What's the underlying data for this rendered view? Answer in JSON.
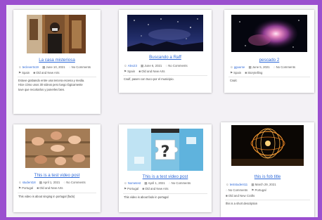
{
  "posts": [
    {
      "title": "La casa misteriosa",
      "author": "tecleverts19",
      "date": "June 10, 2021",
      "comments": "No Comments",
      "language": "Spain",
      "category": "Old and New Arts",
      "excerpt_lines": [
        "Estuve grabando entre una tercera escena y media.",
        "Hice cómo unos 30 videos pero luego lógicamente",
        "tuve que recortarlos y ponerles bien."
      ],
      "thumb_icon": "person-photo"
    },
    {
      "title": "Buscando a Raff",
      "author": "Alex23",
      "date": "June 6, 2021",
      "comments": "No Comments",
      "language": "Spain",
      "category": "Old and New Arts",
      "excerpt_lines": [
        "Csulf, pasen con truco por el municipio."
      ],
      "thumb_icon": "starry-sky-photo"
    },
    {
      "title": "pescado 2",
      "author": "gguurse",
      "date": "June 5, 2021",
      "comments": "No Comments",
      "language": "Spain",
      "category": "Storytelling",
      "excerpt_lines": [
        "Csulc"
      ],
      "thumb_icon": "nebula-photo"
    },
    {
      "title": "This is a test video post",
      "author": "student18",
      "date": "April 1, 2021",
      "comments": "No Comments",
      "language": "Portugal",
      "category": "Old and New Arts",
      "excerpt_lines": [
        "This video is about singing in portugal (fado)"
      ],
      "thumb_icon": "hands-photo"
    },
    {
      "title": "This is a test video post",
      "author": "Nometest",
      "date": "April 1, 2021",
      "comments": "No Comments",
      "language": "Portugal",
      "category": "Old and New Arts",
      "excerpt_lines": [
        "This video is about fado in portugal"
      ],
      "thumb_icon": "puzzle-photo"
    },
    {
      "title": "this is fob title",
      "author": "teststudent11",
      "date": "March 29, 2021",
      "comments": "No Comments",
      "language": "Portugal",
      "category": "Old and New Crafts",
      "excerpt_lines": [
        "this is a short description"
      ],
      "thumb_icon": "light-painting-photo"
    }
  ],
  "icons": {
    "user": "☺",
    "calendar": "▦",
    "comment": "◌",
    "flag": "⚑",
    "category": "■"
  },
  "colors": {
    "page_background": "#9b4fcf",
    "link": "#2f6ad8"
  }
}
